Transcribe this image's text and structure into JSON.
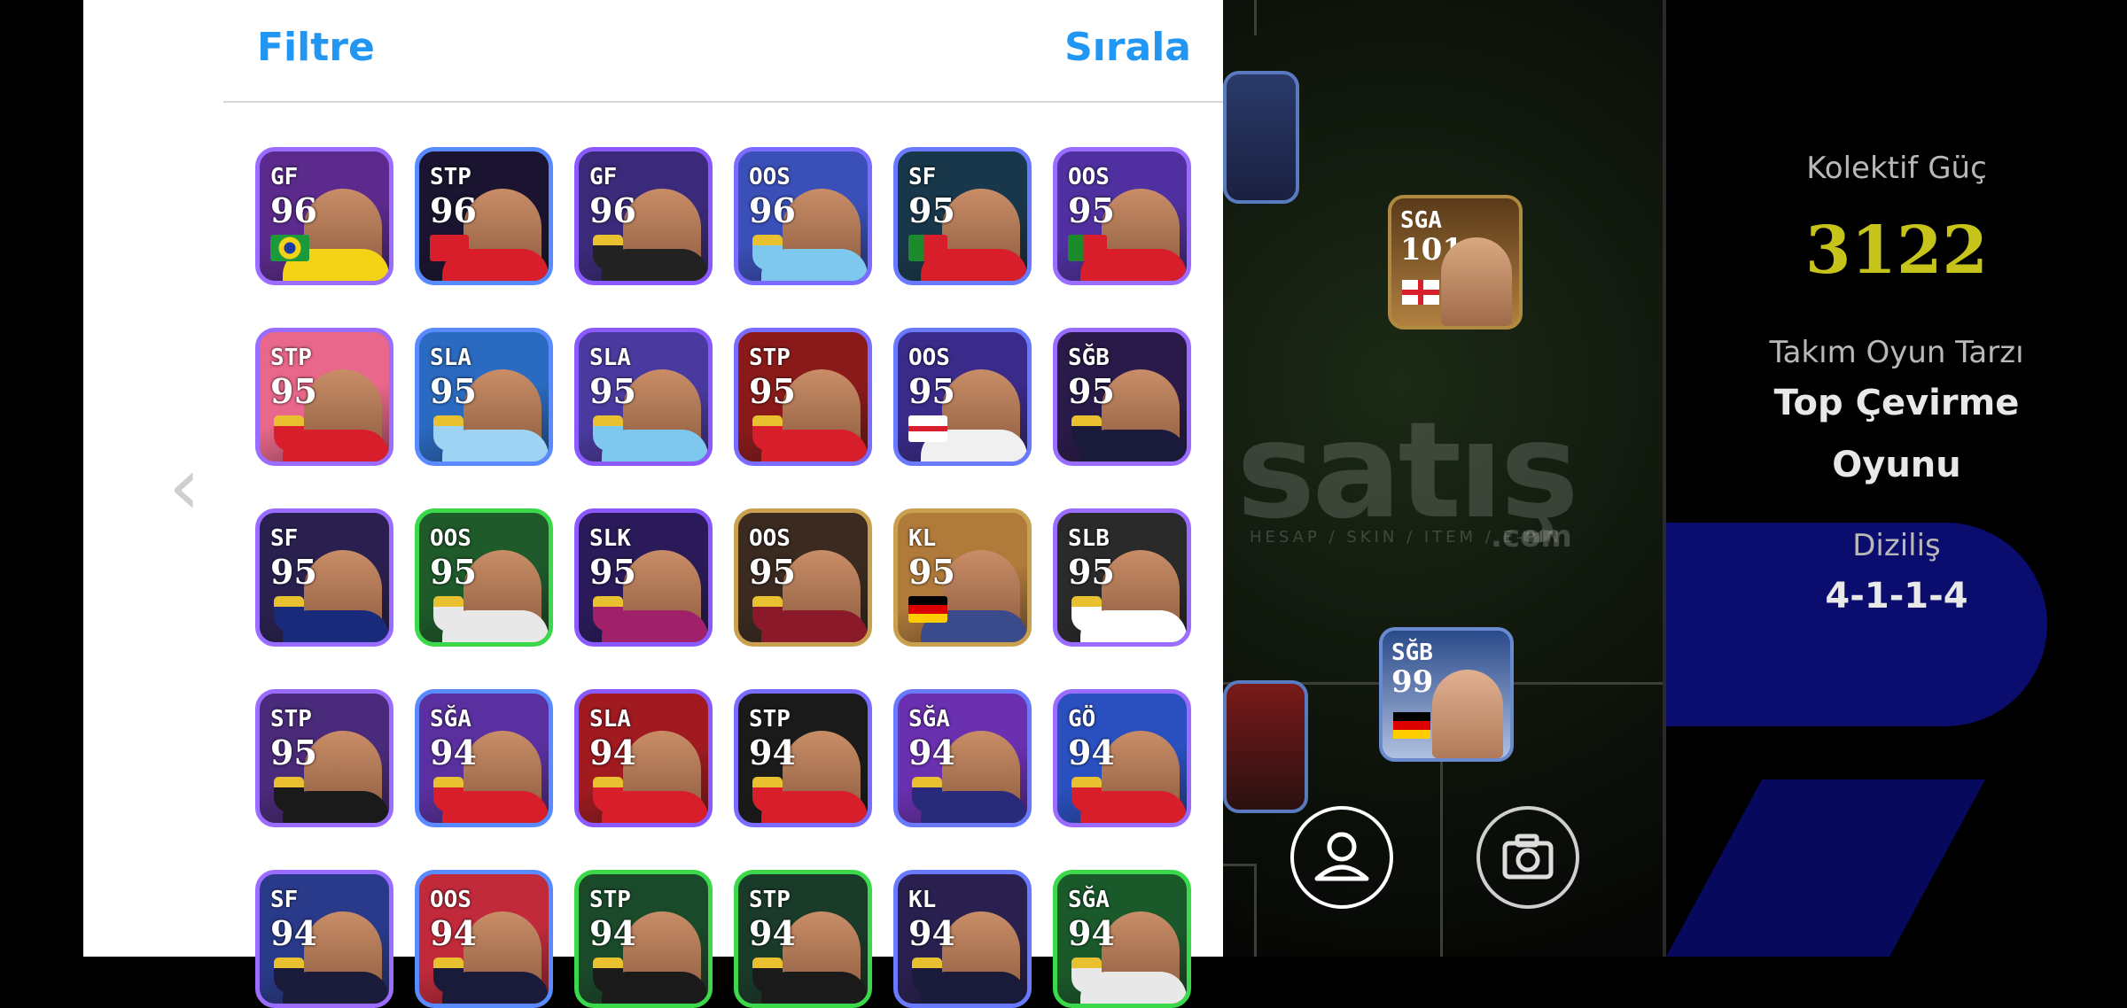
{
  "panel": {
    "filter_label": "Filtre",
    "sort_label": "Sırala"
  },
  "players": [
    {
      "pos": "GF",
      "rating": "96",
      "flag": "brazil-flag",
      "bg": "#5b2a8c",
      "accent": "#f4d317"
    },
    {
      "pos": "STP",
      "rating": "96",
      "flag": "switzerland-flag",
      "bg": "#1a1430",
      "accent": "#d81e2a"
    },
    {
      "pos": "GF",
      "rating": "96",
      "flag": "club-badge",
      "bg": "#3b2a7a",
      "accent": "#222222"
    },
    {
      "pos": "OOS",
      "rating": "96",
      "flag": "club-badge",
      "bg": "#3a4fb8",
      "accent": "#7ec8f0"
    },
    {
      "pos": "SF",
      "rating": "95",
      "flag": "portugal-flag",
      "bg": "#18374a",
      "accent": "#d81e2a"
    },
    {
      "pos": "OOS",
      "rating": "95",
      "flag": "portugal-flag",
      "bg": "#5030a0",
      "accent": "#d81e2a"
    },
    {
      "pos": "STP",
      "rating": "95",
      "flag": "club-badge",
      "bg": "#e8678a",
      "accent": "#d81e2a"
    },
    {
      "pos": "SLA",
      "rating": "95",
      "flag": "club-badge",
      "bg": "#2a6ac0",
      "accent": "#9fd3f4"
    },
    {
      "pos": "SLA",
      "rating": "95",
      "flag": "club-badge",
      "bg": "#4a3aa0",
      "accent": "#7ec8f0"
    },
    {
      "pos": "STP",
      "rating": "95",
      "flag": "club-badge",
      "bg": "#8a1a1a",
      "accent": "#d81e2a"
    },
    {
      "pos": "OOS",
      "rating": "95",
      "flag": "england-flag",
      "bg": "#3a2a8a",
      "accent": "#f0f0f0"
    },
    {
      "pos": "SĞB",
      "rating": "95",
      "flag": "club-badge",
      "bg": "#2a1a4a",
      "accent": "#1a1a3a"
    },
    {
      "pos": "SF",
      "rating": "95",
      "flag": "club-badge",
      "bg": "#2a2050",
      "accent": "#1a2a7a"
    },
    {
      "pos": "OOS",
      "rating": "95",
      "flag": "club-badge",
      "bg": "#1e5a2a",
      "accent": "#e8e8e8"
    },
    {
      "pos": "SLK",
      "rating": "95",
      "flag": "club-badge",
      "bg": "#2a1a5a",
      "accent": "#a0206a"
    },
    {
      "pos": "OOS",
      "rating": "95",
      "flag": "club-badge",
      "bg": "#3a2a20",
      "accent": "#8a1a2a"
    },
    {
      "pos": "KL",
      "rating": "95",
      "flag": "germany-flag",
      "bg": "#b07a3a",
      "accent": "#3a4a8a"
    },
    {
      "pos": "SLB",
      "rating": "95",
      "flag": "club-badge",
      "bg": "#2a2a2a",
      "accent": "#ffffff"
    },
    {
      "pos": "STP",
      "rating": "95",
      "flag": "club-badge",
      "bg": "#4a2a7a",
      "accent": "#1a1a1a"
    },
    {
      "pos": "SĞA",
      "rating": "94",
      "flag": "club-badge",
      "bg": "#5a30a0",
      "accent": "#d81e2a"
    },
    {
      "pos": "SLA",
      "rating": "94",
      "flag": "club-badge",
      "bg": "#a01a20",
      "accent": "#d81e2a"
    },
    {
      "pos": "STP",
      "rating": "94",
      "flag": "club-badge",
      "bg": "#1a1a1a",
      "accent": "#d81e2a"
    },
    {
      "pos": "SĞA",
      "rating": "94",
      "flag": "club-badge",
      "bg": "#6a30b0",
      "accent": "#2a2a7a"
    },
    {
      "pos": "GÖ",
      "rating": "94",
      "flag": "club-badge",
      "bg": "#2a50c0",
      "accent": "#d81e2a"
    },
    {
      "pos": "SF",
      "rating": "94",
      "flag": "club-badge",
      "bg": "#2a3a8a",
      "accent": "#1a1a3a"
    },
    {
      "pos": "OOS",
      "rating": "94",
      "flag": "club-badge",
      "bg": "#c02a3a",
      "accent": "#1a1a3a"
    },
    {
      "pos": "STP",
      "rating": "94",
      "flag": "club-badge",
      "bg": "#1a4a2a",
      "accent": "#1a1a1a"
    },
    {
      "pos": "STP",
      "rating": "94",
      "flag": "club-badge",
      "bg": "#1a3a2a",
      "accent": "#1a1a1a"
    },
    {
      "pos": "KL",
      "rating": "94",
      "flag": "club-badge",
      "bg": "#2a2050",
      "accent": "#1a1a3a"
    },
    {
      "pos": "SĞA",
      "rating": "94",
      "flag": "club-badge",
      "bg": "#1a5a2a",
      "accent": "#e8e8e8"
    }
  ],
  "pitch": {
    "watermark": "satış",
    "watermark_sub": "HESAP / SKIN / ITEM / E-PIN",
    "watermark_com": ".com",
    "mini_cards": [
      {
        "pos": "SGA",
        "rating": "101",
        "flag": "england-flag"
      },
      {
        "pos": "SĞB",
        "rating": "99",
        "flag": "germany-flag"
      }
    ]
  },
  "info": {
    "power_label": "Kolektif Güç",
    "power_value": "3122",
    "style_label": "Takım Oyun Tarzı",
    "style_value_1": "Top Çevirme",
    "style_value_2": "Oyunu",
    "formation_label": "Diziliş",
    "formation_value": "4-1-1-4"
  }
}
